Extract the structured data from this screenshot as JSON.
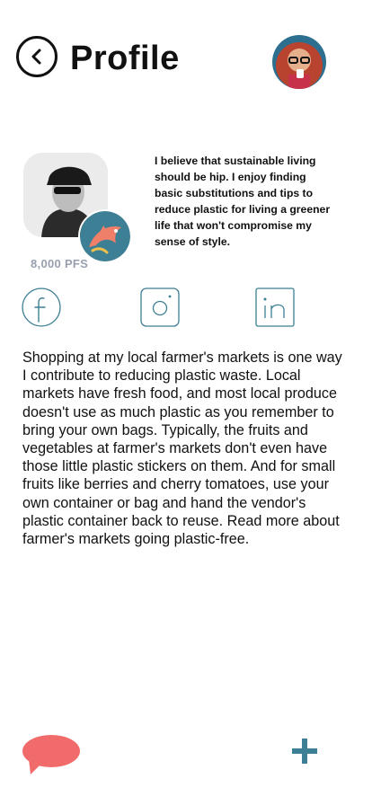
{
  "header": {
    "title": "Profile"
  },
  "profile": {
    "points": "8,000 PFS",
    "bio": "I believe that sustainable living should be hip. I enjoy finding basic substitutions and tips to reduce plastic for living a greener life that won't compromise my sense of style."
  },
  "social": {
    "facebook_icon": "facebook-icon",
    "instagram_icon": "instagram-icon",
    "linkedin_icon": "linkedin-icon"
  },
  "post": {
    "text": "Shopping at my local farmer's markets is one way I contribute to reducing plastic waste. Local markets have fresh food, and most local produce doesn't use as much plastic as you remember to bring your own bags. Typically, the fruits and vegetables at farmer's markets don't even have those little plastic stickers on them. And for small fruits like berries and cherry tomatoes, use your own container or bag and hand the vendor's plastic container back to reuse. Read more about farmer's markets going plastic-free."
  },
  "colors": {
    "accent_blue": "#3d7f94",
    "chat_red": "#f26b6b",
    "muted_text": "#98a0b0"
  }
}
